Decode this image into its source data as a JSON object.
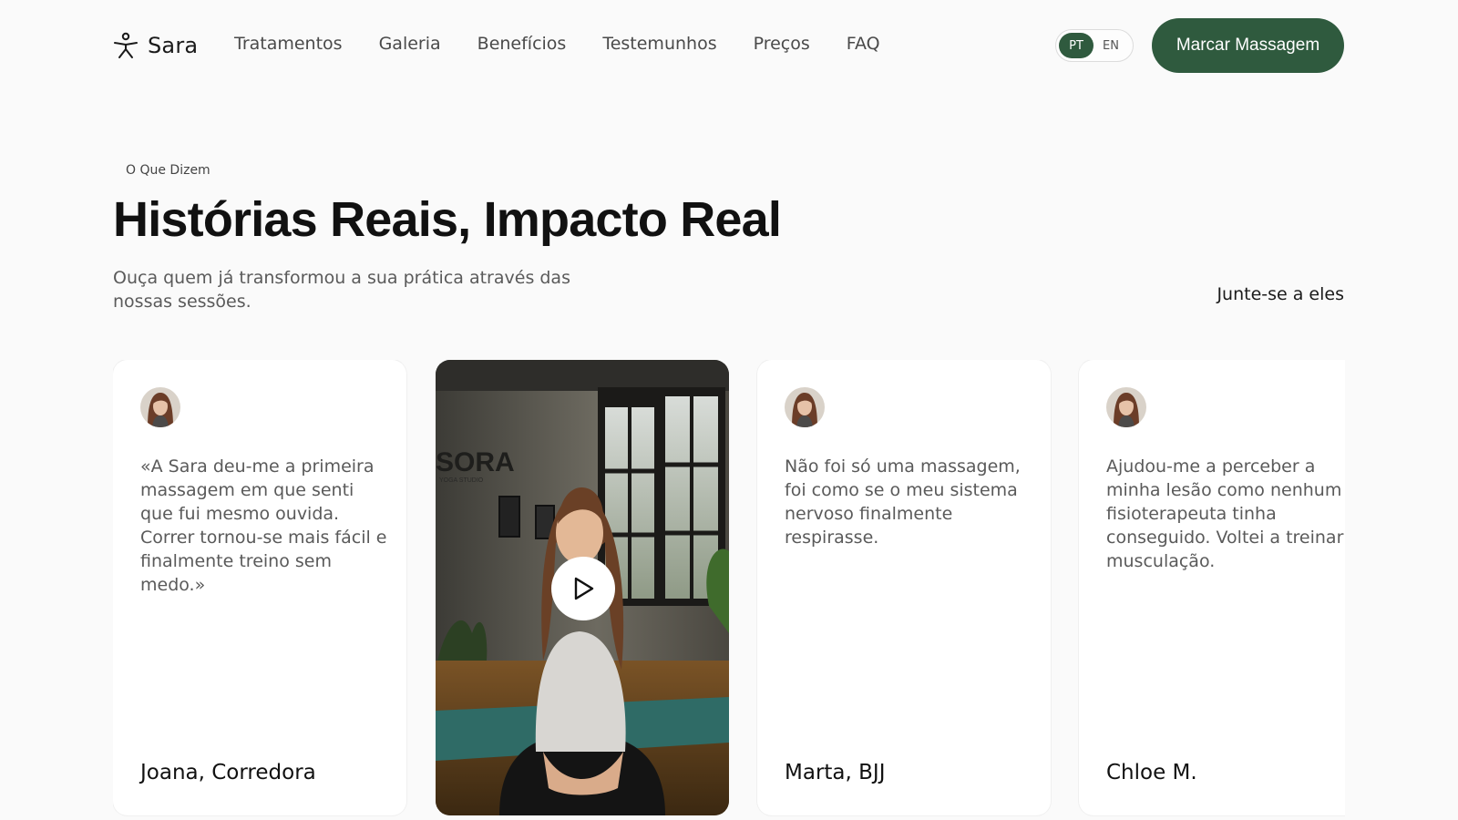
{
  "brand": {
    "name": "Sara",
    "icon": "person-stretch-icon"
  },
  "nav": {
    "items": [
      "Tratamentos",
      "Galeria",
      "Benefícios",
      "Testemunhos",
      "Preços",
      "FAQ"
    ]
  },
  "language": {
    "options": [
      "PT",
      "EN"
    ],
    "selected": "PT"
  },
  "header_cta": "Marcar Massagem",
  "section": {
    "eyebrow": "O Que Dizem",
    "title": "Histórias Reais, Impacto Real",
    "subtitle": "Ouça quem já transformou a sua prática através das nossas sessões.",
    "join_link": "Junte-se a eles"
  },
  "testimonials": [
    {
      "type": "text",
      "quote": "«A Sara deu-me a primeira massagem em que senti que fui mesmo ouvida. Correr tornou-se mais fácil e finalmente treino sem medo.»",
      "author": "Joana, Corredora"
    },
    {
      "type": "video",
      "wall_sign": "SORA",
      "wall_sign_sub": "YOGA STUDIO",
      "play_icon": "play-icon"
    },
    {
      "type": "text",
      "quote": "Não foi só uma massagem, foi como se o meu sistema nervoso finalmente respirasse.",
      "author": "Marta, BJJ"
    },
    {
      "type": "text",
      "quote": "Ajudou-me a perceber a minha lesão como nenhum fisioterapeuta tinha conseguido. Voltei a treinar musculação.",
      "author": "Chloe M."
    }
  ],
  "colors": {
    "accent": "#2f5a3e",
    "background": "#fafafa",
    "card": "#ffffff",
    "text_muted": "#5a5a5a"
  }
}
